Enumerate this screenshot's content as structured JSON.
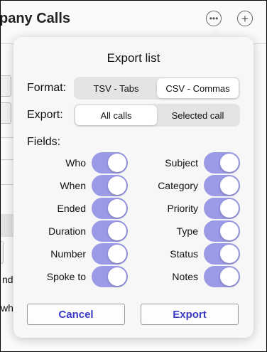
{
  "background": {
    "title": "pany Calls",
    "snippets": [
      "nd",
      "whe"
    ]
  },
  "popover": {
    "title": "Export list",
    "format": {
      "label": "Format:",
      "options": [
        "TSV - Tabs",
        "CSV - Commas"
      ],
      "selected": "CSV - Commas"
    },
    "export": {
      "label": "Export:",
      "options": [
        "All calls",
        "Selected call"
      ],
      "selected": "All calls"
    },
    "fields_label": "Fields:",
    "fields_left": [
      {
        "name": "Who",
        "on": true
      },
      {
        "name": "When",
        "on": true
      },
      {
        "name": "Ended",
        "on": true
      },
      {
        "name": "Duration",
        "on": true
      },
      {
        "name": "Number",
        "on": true
      },
      {
        "name": "Spoke to",
        "on": true
      }
    ],
    "fields_right": [
      {
        "name": "Subject",
        "on": true
      },
      {
        "name": "Category",
        "on": true
      },
      {
        "name": "Priority",
        "on": true
      },
      {
        "name": "Type",
        "on": true
      },
      {
        "name": "Status",
        "on": true
      },
      {
        "name": "Notes",
        "on": true
      }
    ],
    "cancel_label": "Cancel",
    "export_label": "Export"
  },
  "colors": {
    "accent": "#3a3ac8",
    "toggle_on": "#9a9ae6"
  }
}
